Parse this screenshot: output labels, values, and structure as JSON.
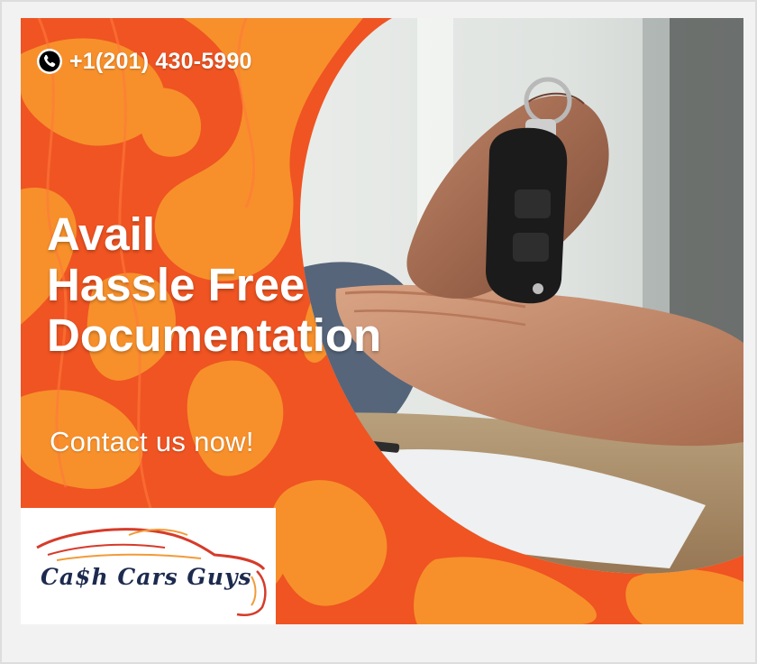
{
  "banner": {
    "phone": "+1(201) 430-5990",
    "headline": [
      "Avail",
      "Hassle Free",
      "Documentation"
    ],
    "cta": "Contact us now!"
  },
  "logo": {
    "text": "Ca$h Cars Guys"
  },
  "colors": {
    "orange_dark": "#ef5422",
    "orange_light": "#f7902b",
    "navy": "#1d2a4f",
    "logo_red": "#d63b2a",
    "logo_orange": "#f29b38"
  },
  "icons": {
    "phone": "phone-icon",
    "car": "car-silhouette-logo"
  }
}
